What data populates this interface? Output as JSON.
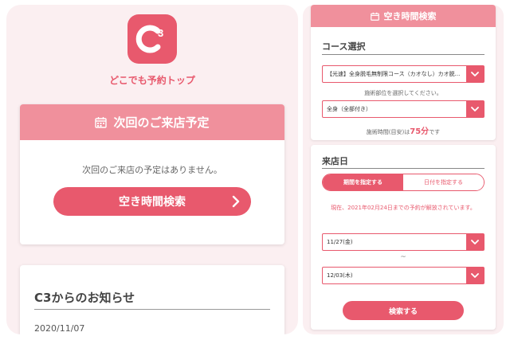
{
  "left": {
    "logo": {
      "icon": "c3-logo-icon"
    },
    "logo_caption": "どこでも予約トップ",
    "next_visit": {
      "title": "次回のご来店予定",
      "message": "次回のご来店の予定はありません。",
      "search_label": "空き時間検索"
    },
    "news": {
      "title": "C3からのお知らせ",
      "date": "2020/11/07"
    }
  },
  "right": {
    "header": "空き時間検索",
    "course": {
      "title": "コース選択",
      "course_value": "【光速】全身脱毛無制限コース（カオなし）カオ脱...",
      "part_hint": "施術部位を選択してください。",
      "part_value": "全身（全部付き）",
      "time_prefix": "施術時間(目安)は",
      "time_value": "75分",
      "time_suffix": "です"
    },
    "visit": {
      "title": "来店日",
      "toggle_period": "期間を指定する",
      "toggle_date": "日付を指定する",
      "notice": "現在、2021年02月24日までの予約が解放されています。",
      "from_value": "11/27(金)",
      "tilde": "~",
      "to_value": "12/03(木)",
      "search_label": "検索する"
    }
  },
  "colors": {
    "accent": "#e8596d",
    "header_pink": "#f0909c",
    "bg_pink": "#fbeff1"
  }
}
